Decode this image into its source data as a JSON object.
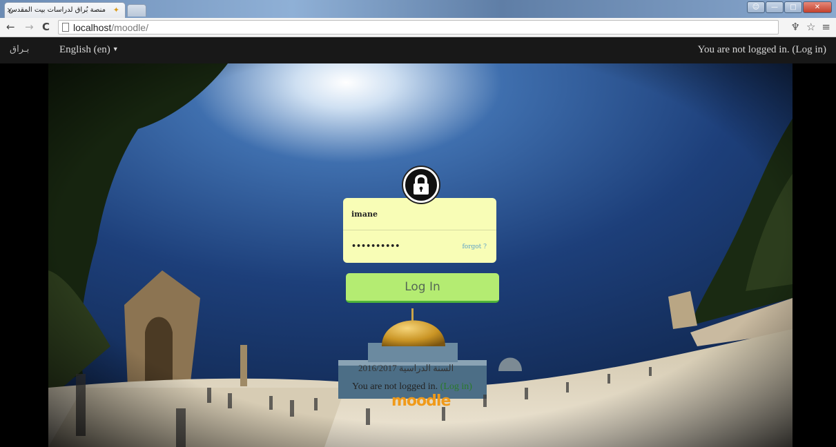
{
  "browser": {
    "tab_title": "منصة بُراق لدراسات بيت المقدس",
    "tab_close": "×",
    "url_host": "localhost",
    "url_path": "/moodle/"
  },
  "navbar": {
    "brand": "بـراق",
    "language": "English (en)",
    "login_status": "You are not logged in. (Log in)"
  },
  "login": {
    "username": "imane",
    "password_mask": "••••••••••",
    "forgot_label": "forgot ?",
    "button_label": "Log In"
  },
  "footer": {
    "year_text": "السنة الدراسية 2016/2017",
    "login_prefix": "You are not logged in.",
    "login_link": "(Log in)",
    "moodle": "moodle"
  },
  "colors": {
    "card": "#f8fdb6",
    "button": "#b4ec72",
    "button_border": "#4fb33a",
    "navbar": "#181818"
  }
}
